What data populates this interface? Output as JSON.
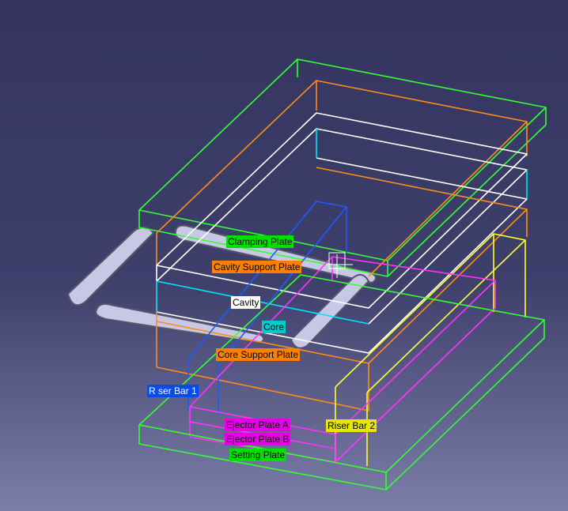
{
  "background": {
    "top": "#34345f",
    "bottom": "#7b7ea8"
  },
  "parts": [
    {
      "label": "Clamping Plate",
      "bg": "#00e000",
      "fg": "#000000",
      "wire": "#33ff33"
    },
    {
      "label": "Cavity Support Plate",
      "bg": "#ff7f00",
      "fg": "#000000",
      "wire": "#ff8c1a"
    },
    {
      "label": "Cavity",
      "bg": "#ffffff",
      "fg": "#000000",
      "wire": "#ffffff"
    },
    {
      "label": "Core",
      "bg": "#00cccc",
      "fg": "#000000",
      "wire": "#00e5ff"
    },
    {
      "label": "Core Support Plate",
      "bg": "#ff7f00",
      "fg": "#000000",
      "wire": "#ff8c1a"
    },
    {
      "label": "R ser Bar 1",
      "bg": "#0a4de6",
      "fg": "#ffffff",
      "wire": "#1a5cff"
    },
    {
      "label": "Riser Bar 2",
      "bg": "#e6e600",
      "fg": "#000000",
      "wire": "#ffff33"
    },
    {
      "label": "Ejector Plate A",
      "bg": "#e600e6",
      "fg": "#000000",
      "wire": "#ff33ff"
    },
    {
      "label": "Ejector Plate B",
      "bg": "#e600e6",
      "fg": "#000000",
      "wire": "#ff33ff"
    },
    {
      "label": "Setting Plate",
      "bg": "#00e000",
      "fg": "#000000",
      "wire": "#33ff33"
    }
  ],
  "handles": {
    "fill": "#c8c8e6",
    "stroke": "#55556b"
  }
}
